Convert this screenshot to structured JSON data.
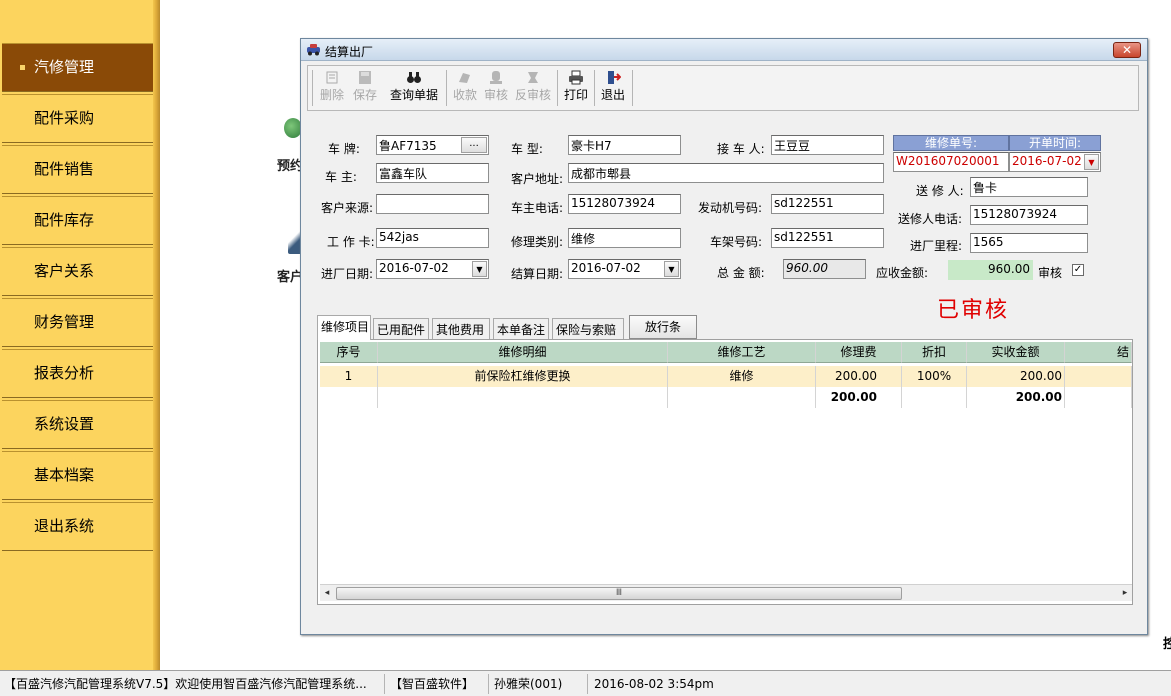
{
  "sidebar": {
    "items": [
      {
        "label": "汽修管理",
        "active": true
      },
      {
        "label": "配件采购",
        "active": false
      },
      {
        "label": "配件销售",
        "active": false
      },
      {
        "label": "配件库存",
        "active": false
      },
      {
        "label": "客户关系",
        "active": false
      },
      {
        "label": "财务管理",
        "active": false
      },
      {
        "label": "报表分析",
        "active": false
      },
      {
        "label": "系统设置",
        "active": false
      },
      {
        "label": "基本档案",
        "active": false
      },
      {
        "label": "退出系统",
        "active": false
      }
    ]
  },
  "background": {
    "fragment1": "预约",
    "fragment2": "客户",
    "edge_char": "控"
  },
  "dialog": {
    "title": "结算出厂",
    "close_label": "✕",
    "toolbar": {
      "delete": "删除",
      "save": "保存",
      "query": "查询单据",
      "collect": "收款",
      "approve": "审核",
      "unapprove": "反审核",
      "print": "打印",
      "exit": "退出"
    },
    "form": {
      "plate_label": "车    牌:",
      "plate": "鲁AF7135",
      "plate_btn": "...",
      "model_label": "车    型:",
      "model": "豪卡H7",
      "receiver_label": "接 车 人:",
      "receiver": "王豆豆",
      "repair_no_header": "维修单号:",
      "open_time_header": "开单时间:",
      "repair_no": "W201607020001",
      "open_time": "2016-07-02",
      "owner_label": "车    主:",
      "owner": "富鑫车队",
      "address_label": "客户地址:",
      "address": "成都市郫县",
      "sender_label": "送 修 人:",
      "sender": "鲁卡",
      "source_label": "客户来源:",
      "source": "",
      "owner_phone_label": "车主电话:",
      "owner_phone": "15128073924",
      "engine_label": "发动机号码:",
      "engine": "sd122551",
      "sender_phone_label": "送修人电话:",
      "sender_phone": "15128073924",
      "workcard_label": "工 作 卡:",
      "workcard": "542jas",
      "repair_type_label": "修理类别:",
      "repair_type": "维修",
      "frame_label": "车架号码:",
      "frame": "sd122551",
      "mileage_label": "进厂里程:",
      "mileage": "1565",
      "entry_date_label": "进厂日期:",
      "entry_date": "2016-07-02",
      "settle_date_label": "结算日期:",
      "settle_date": "2016-07-02",
      "total_label": "总 金 额:",
      "total": "960.00",
      "receivable_label": "应收金额:",
      "receivable": "960.00",
      "approve_label": "审核",
      "approve_checked": "✓"
    },
    "approved_stamp": "已审核",
    "tabs": [
      "维修项目",
      "已用配件",
      "其他费用",
      "本单备注",
      "保险与索赔"
    ],
    "release_button": "放行条",
    "grid": {
      "headers": [
        "序号",
        "维修明细",
        "维修工艺",
        "修理费",
        "折扣",
        "实收金额",
        "结"
      ],
      "rows": [
        [
          "1",
          "前保险杠维修更换",
          "维修",
          "200.00",
          "100%",
          "200.00",
          ""
        ]
      ],
      "summary": [
        "",
        "",
        "",
        "200.00",
        "",
        "200.00",
        ""
      ]
    },
    "scroll": {
      "left": "◂",
      "right": "▸",
      "thumb": "Ⅲ"
    }
  },
  "statusbar": {
    "app": "【百盛汽修汽配管理系统V7.5】欢迎使用智百盛汽修汽配管理系统...",
    "company": "【智百盛软件】",
    "user": "孙雅荣(001)",
    "datetime": "2016-08-02 3:54pm"
  }
}
